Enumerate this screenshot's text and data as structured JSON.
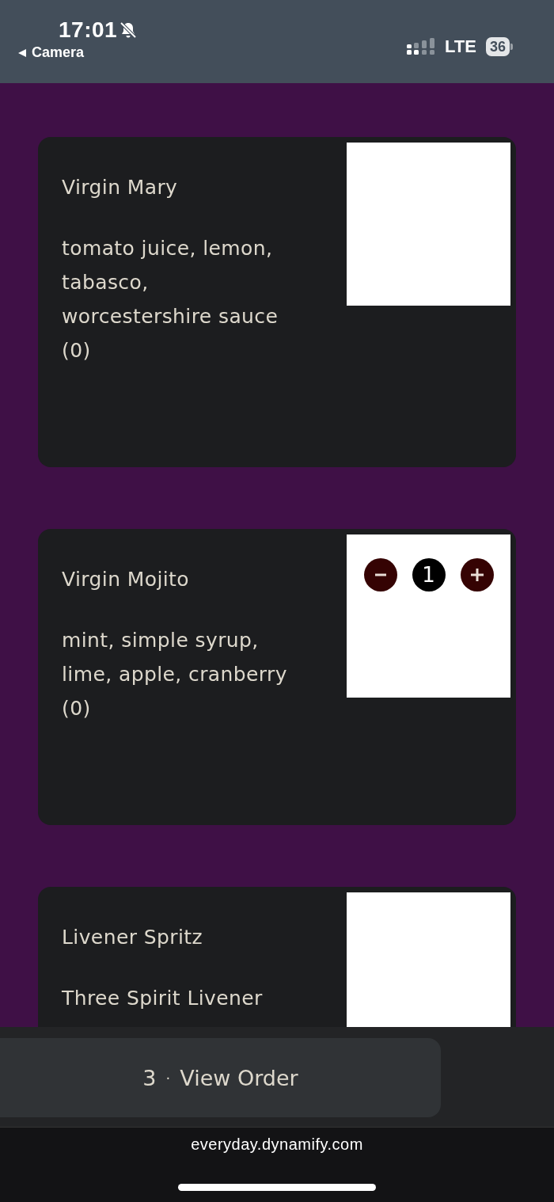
{
  "status_bar": {
    "time": "17:01",
    "back_label": "Camera",
    "network": "LTE",
    "battery": "36"
  },
  "items": [
    {
      "name": "Virgin Mary",
      "description": "tomato juice, lemon, tabasco, worcestershire sauce (0)"
    },
    {
      "name": "Virgin Mojito",
      "description": "mint, simple syrup, lime, apple, cranberry (0)",
      "quantity": "1"
    },
    {
      "name": "Livener Spritz",
      "description": "Three Spirit Livener"
    }
  ],
  "order_button": {
    "count": "3",
    "separator": "·",
    "label": "View Order"
  },
  "browser": {
    "url": "everyday.dynamify.com"
  }
}
